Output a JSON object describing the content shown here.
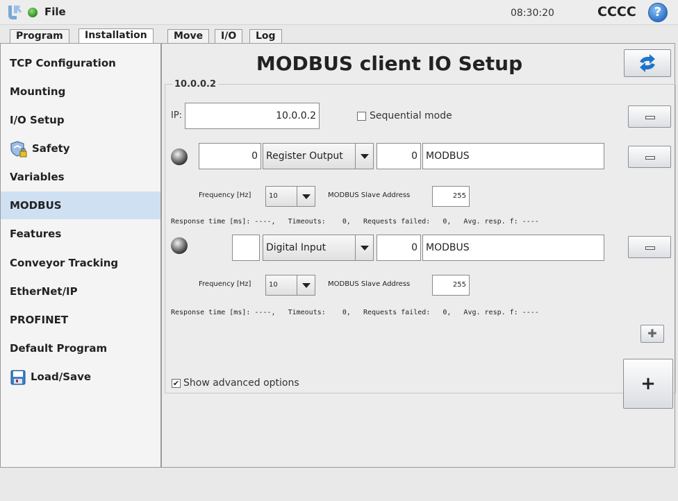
{
  "topbar": {
    "file_label": "File",
    "clock": "08:30:20",
    "robot_name": "CCCC",
    "help_symbol": "?"
  },
  "tabs": {
    "program": "Program",
    "installation": "Installation",
    "move": "Move",
    "io": "I/O",
    "log": "Log"
  },
  "sidebar": {
    "items": [
      {
        "label": "TCP Configuration"
      },
      {
        "label": "Mounting"
      },
      {
        "label": "I/O Setup"
      },
      {
        "label": "Safety",
        "icon": "shield-lock-icon"
      },
      {
        "label": "Variables"
      },
      {
        "label": "MODBUS"
      },
      {
        "label": "Features"
      },
      {
        "label": "Conveyor Tracking"
      },
      {
        "label": "EtherNet/IP"
      },
      {
        "label": "PROFINET"
      },
      {
        "label": "Default Program"
      },
      {
        "label": "Load/Save",
        "icon": "floppy-disk-icon"
      }
    ],
    "active_index": 5
  },
  "main": {
    "title": "MODBUS client IO Setup",
    "group_label": "10.0.0.2",
    "ip_label": "IP:",
    "ip_value": "10.0.0.2",
    "sequential_label": "Sequential mode",
    "signals": [
      {
        "address": "0",
        "type": "Register Output",
        "register": "0",
        "name": "MODBUS",
        "freq_label": "Frequency [Hz]",
        "freq": "10",
        "slave_label": "MODBUS Slave Address",
        "slave": "255",
        "stats": "Response time [ms]: ----,   Timeouts:    0,   Requests failed:   0,   Avg. resp. f: ----"
      },
      {
        "address": "",
        "type": "Digital Input",
        "register": "0",
        "name": "MODBUS",
        "freq_label": "Frequency [Hz]",
        "freq": "10",
        "slave_label": "MODBUS Slave Address",
        "slave": "255",
        "stats": "Response time [ms]: ----,   Timeouts:    0,   Requests failed:   0,   Avg. resp. f: ----"
      }
    ],
    "advanced_label": "Show advanced options",
    "advanced_checked": true,
    "add_symbol": "+",
    "add_signal_symbol": "✚"
  },
  "colors": {
    "active_sidebar": "#cfe0f3",
    "status_dot": "#2d8a1c",
    "help_blue": "#2f73c8",
    "refresh_blue": "#1e74c9"
  }
}
